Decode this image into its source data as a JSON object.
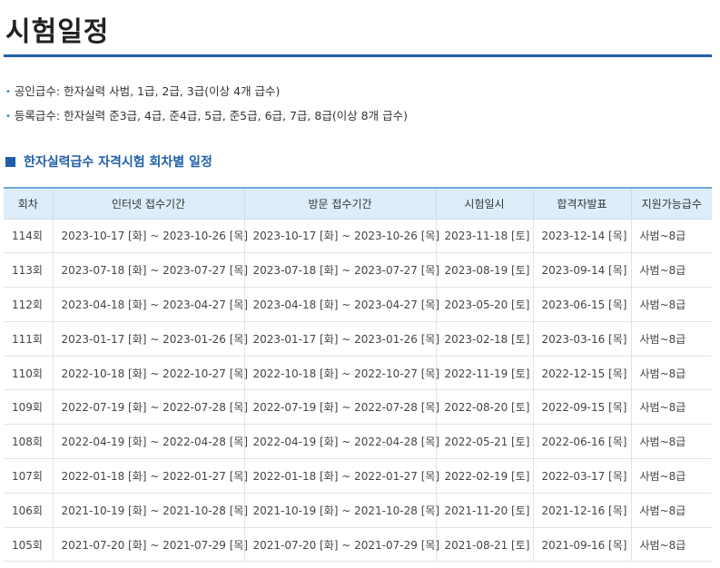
{
  "page": {
    "title": "시험일정"
  },
  "bullets": [
    "공인급수: 한자실력 사범, 1급, 2급, 3급(이상 4개 급수)",
    "등록급수: 한자실력 준3급, 4급, 준4급, 5급, 준5급, 6급, 7급, 8급(이상 8개 급수)"
  ],
  "section": {
    "heading": "한자실력급수 자격시험 회차별 일정"
  },
  "colors": {
    "accent": "#1f5fa9",
    "header_bg": "#ddeefa",
    "header_border": "#6fa7d8"
  },
  "table": {
    "columns": [
      "회차",
      "인터넷 접수기간",
      "방문 접수기간",
      "시험일시",
      "합격자발표",
      "지원가능급수"
    ],
    "rows": [
      [
        "114회",
        "2023-10-17 [화] ~ 2023-10-26 [목]",
        "2023-10-17 [화] ~ 2023-10-26 [목]",
        "2023-11-18 [토]",
        "2023-12-14 [목]",
        "사범~8급"
      ],
      [
        "113회",
        "2023-07-18 [화] ~ 2023-07-27 [목]",
        "2023-07-18 [화] ~ 2023-07-27 [목]",
        "2023-08-19 [토]",
        "2023-09-14 [목]",
        "사범~8급"
      ],
      [
        "112회",
        "2023-04-18 [화] ~ 2023-04-27 [목]",
        "2023-04-18 [화] ~ 2023-04-27 [목]",
        "2023-05-20 [토]",
        "2023-06-15 [목]",
        "사범~8급"
      ],
      [
        "111회",
        "2023-01-17 [화] ~ 2023-01-26 [목]",
        "2023-01-17 [화] ~ 2023-01-26 [목]",
        "2023-02-18 [토]",
        "2023-03-16 [목]",
        "사범~8급"
      ],
      [
        "110회",
        "2022-10-18 [화] ~ 2022-10-27 [목]",
        "2022-10-18 [화] ~ 2022-10-27 [목]",
        "2022-11-19 [토]",
        "2022-12-15 [목]",
        "사범~8급"
      ],
      [
        "109회",
        "2022-07-19 [화] ~ 2022-07-28 [목]",
        "2022-07-19 [화] ~ 2022-07-28 [목]",
        "2022-08-20 [토]",
        "2022-09-15 [목]",
        "사범~8급"
      ],
      [
        "108회",
        "2022-04-19 [화] ~ 2022-04-28 [목]",
        "2022-04-19 [화] ~ 2022-04-28 [목]",
        "2022-05-21 [토]",
        "2022-06-16 [목]",
        "사범~8급"
      ],
      [
        "107회",
        "2022-01-18 [화] ~ 2022-01-27 [목]",
        "2022-01-18 [화] ~ 2022-01-27 [목]",
        "2022-02-19 [토]",
        "2022-03-17 [목]",
        "사범~8급"
      ],
      [
        "106회",
        "2021-10-19 [화] ~ 2021-10-28 [목]",
        "2021-10-19 [화] ~ 2021-10-28 [목]",
        "2021-11-20 [토]",
        "2021-12-16 [목]",
        "사범~8급"
      ],
      [
        "105회",
        "2021-07-20 [화] ~ 2021-07-29 [목]",
        "2021-07-20 [화] ~ 2021-07-29 [목]",
        "2021-08-21 [토]",
        "2021-09-16 [목]",
        "사범~8급"
      ]
    ]
  }
}
